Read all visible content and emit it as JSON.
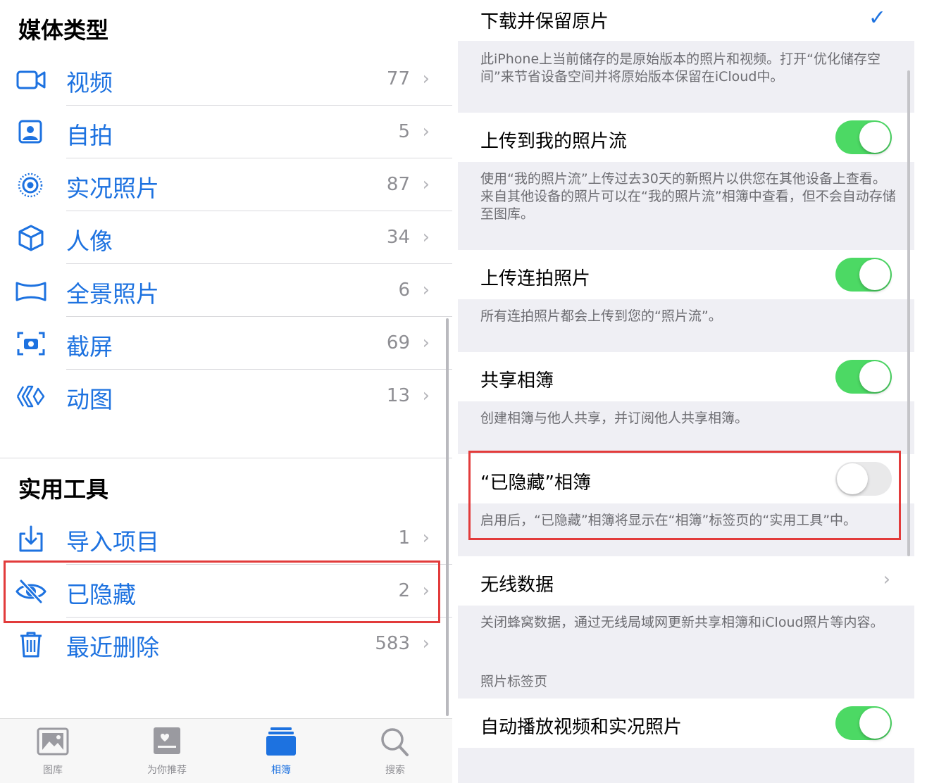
{
  "left": {
    "media_types_title": "媒体类型",
    "media_items": [
      {
        "label": "视频",
        "count": "77",
        "icon": "video-icon"
      },
      {
        "label": "自拍",
        "count": "5",
        "icon": "selfie-icon"
      },
      {
        "label": "实况照片",
        "count": "87",
        "icon": "live-photo-icon"
      },
      {
        "label": "人像",
        "count": "34",
        "icon": "portrait-cube-icon"
      },
      {
        "label": "全景照片",
        "count": "6",
        "icon": "panorama-icon"
      },
      {
        "label": "截屏",
        "count": "69",
        "icon": "screenshot-icon"
      },
      {
        "label": "动图",
        "count": "13",
        "icon": "animated-icon"
      }
    ],
    "utilities_title": "实用工具",
    "utility_items": [
      {
        "label": "导入项目",
        "count": "1",
        "icon": "import-icon"
      },
      {
        "label": "已隐藏",
        "count": "2",
        "icon": "hidden-eye-icon"
      },
      {
        "label": "最近删除",
        "count": "583",
        "icon": "trash-icon"
      }
    ],
    "chevron": "›",
    "tabbar": [
      {
        "label": "图库",
        "icon": "library-icon",
        "active": false
      },
      {
        "label": "为你推荐",
        "icon": "for-you-icon",
        "active": false
      },
      {
        "label": "相簿",
        "icon": "albums-icon",
        "active": true
      },
      {
        "label": "搜索",
        "icon": "search-icon",
        "active": false
      }
    ]
  },
  "right": {
    "download_keep_label": "下载并保留原片",
    "checkmark": "✓",
    "download_footer": "此iPhone上当前储存的是原始版本的照片和视频。打开“优化储存空间”来节省设备空间并将原始版本保留在iCloud中。",
    "photo_stream_label": "上传到我的照片流",
    "photo_stream_footer": "使用“我的照片流”上传过去30天的新照片以供您在其他设备上查看。来自其他设备的照片可以在“我的照片流”相簿中查看，但不会自动存储至图库。",
    "burst_label": "上传连拍照片",
    "burst_footer": "所有连拍照片都会上传到您的“照片流”。",
    "shared_label": "共享相簿",
    "shared_footer": "创建相簿与他人共享，并订阅他人共享相簿。",
    "hidden_label": "“已隐藏”相簿",
    "hidden_footer": "启用后，“已隐藏”相簿将显示在“相簿”标签页的“实用工具”中。",
    "wireless_label": "无线数据",
    "wireless_footer": "关闭蜂窝数据，通过无线局域网更新共享相簿和iCloud照片等内容。",
    "photos_tab_header": "照片标签页",
    "autoplay_label": "自动播放视频和实况照片",
    "chevron": "›"
  },
  "colors": {
    "accent": "#1d72e0",
    "toggle_on": "#4cd964",
    "highlight": "#e23b3b"
  }
}
